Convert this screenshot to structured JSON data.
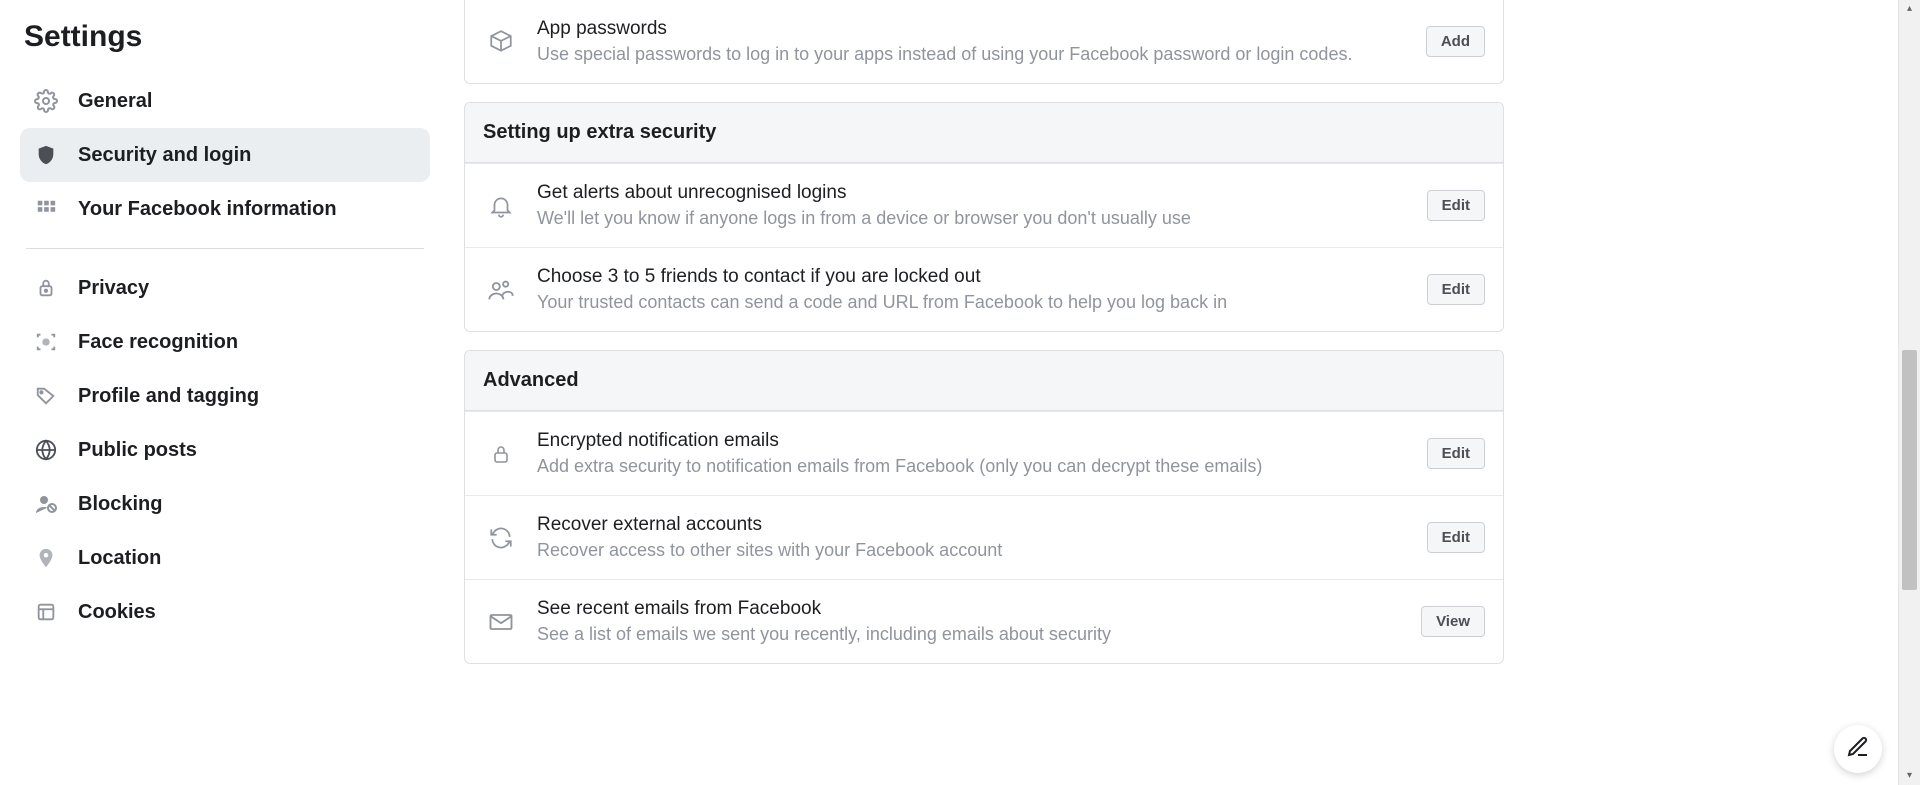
{
  "sidebar": {
    "title": "Settings",
    "items": [
      {
        "label": "General"
      },
      {
        "label": "Security and login"
      },
      {
        "label": "Your Facebook information"
      },
      {
        "label": "Privacy"
      },
      {
        "label": "Face recognition"
      },
      {
        "label": "Profile and tagging"
      },
      {
        "label": "Public posts"
      },
      {
        "label": "Blocking"
      },
      {
        "label": "Location"
      },
      {
        "label": "Cookies"
      }
    ]
  },
  "sections": {
    "app_passwords": {
      "title": "App passwords",
      "desc": "Use special passwords to log in to your apps instead of using your Facebook password or login codes.",
      "button": "Add"
    },
    "extra_security": {
      "header": "Setting up extra security",
      "alerts": {
        "title": "Get alerts about unrecognised logins",
        "desc": "We'll let you know if anyone logs in from a device or browser you don't usually use",
        "button": "Edit"
      },
      "trusted": {
        "title": "Choose 3 to 5 friends to contact if you are locked out",
        "desc": "Your trusted contacts can send a code and URL from Facebook to help you log back in",
        "button": "Edit"
      }
    },
    "advanced": {
      "header": "Advanced",
      "encrypted": {
        "title": "Encrypted notification emails",
        "desc": "Add extra security to notification emails from Facebook (only you can decrypt these emails)",
        "button": "Edit"
      },
      "recover": {
        "title": "Recover external accounts",
        "desc": "Recover access to other sites with your Facebook account",
        "button": "Edit"
      },
      "recent_emails": {
        "title": "See recent emails from Facebook",
        "desc": "See a list of emails we sent you recently, including emails about security",
        "button": "View"
      }
    }
  }
}
